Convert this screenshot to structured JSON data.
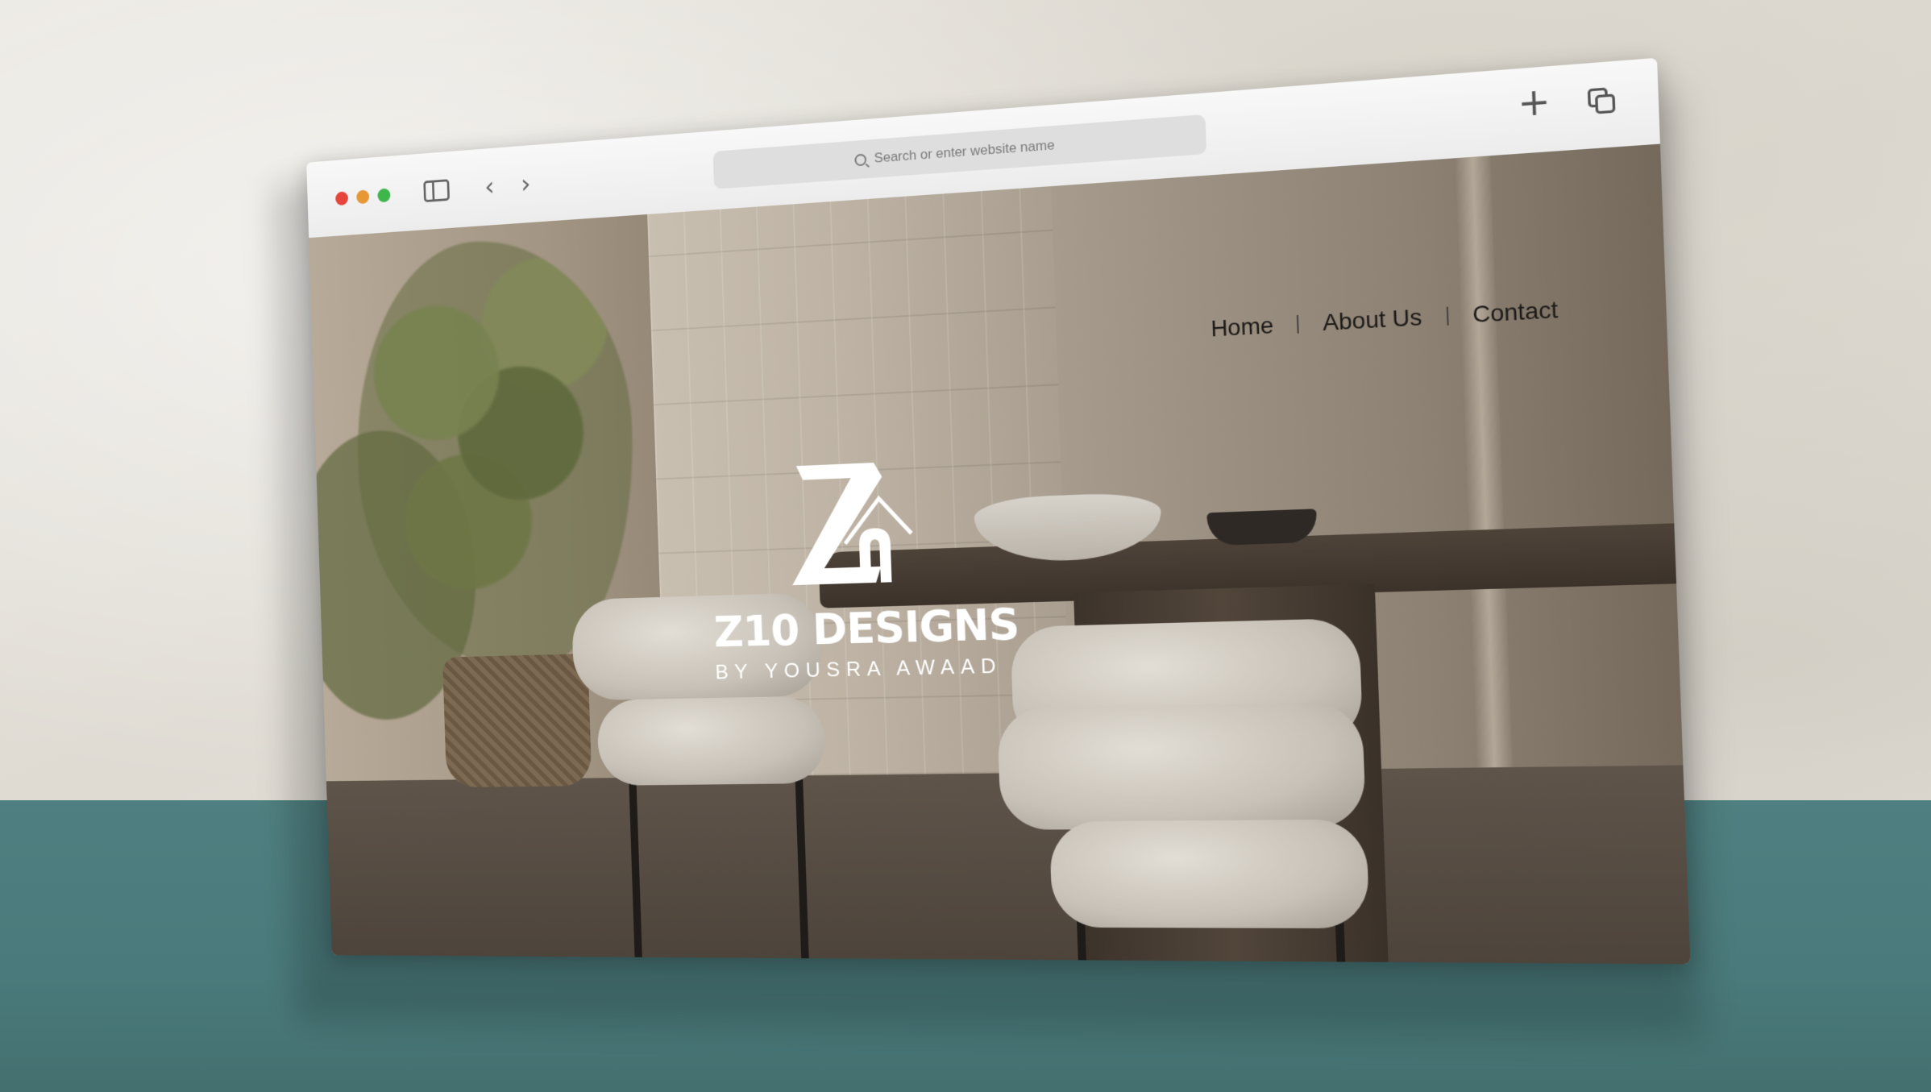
{
  "browser": {
    "address_placeholder": "Search or enter website name",
    "icons": [
      "sidebar-icon",
      "back-icon",
      "forward-icon",
      "search-icon",
      "new-tab-icon",
      "tabs-overview-icon"
    ]
  },
  "nav": {
    "items": [
      {
        "label": "Home"
      },
      {
        "label": "About Us"
      },
      {
        "label": "Contact"
      }
    ]
  },
  "hero": {
    "logo_monogram": "Z10",
    "brand_name": "Z10 DESIGNS",
    "tagline": "BY YOUSRA AWAAD"
  },
  "colors": {
    "traffic_red": "#e5453b",
    "traffic_orange": "#e79734",
    "traffic_green": "#3fb64b",
    "teal_surface": "#4f7f80",
    "paper_background": "#e6e2db"
  }
}
